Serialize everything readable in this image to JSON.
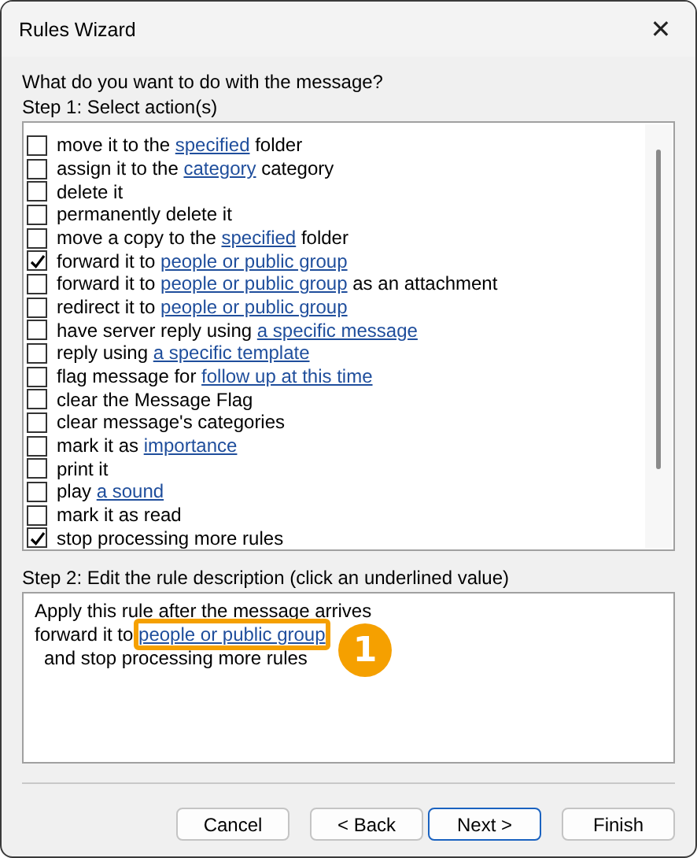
{
  "window": {
    "title": "Rules Wizard",
    "close": "✕"
  },
  "question": "What do you want to do with the message?",
  "step1": {
    "label": "Step 1: Select action(s)",
    "actions": [
      {
        "before": "move it to the ",
        "link": "specified",
        "after": " folder",
        "checked": false
      },
      {
        "before": "assign it to the ",
        "link": "category",
        "after": " category",
        "checked": false
      },
      {
        "before": "delete it",
        "checked": false
      },
      {
        "before": "permanently delete it",
        "checked": false
      },
      {
        "before": "move a copy to the ",
        "link": "specified",
        "after": " folder",
        "checked": false
      },
      {
        "before": "forward it to ",
        "link": "people or public group",
        "checked": true
      },
      {
        "before": "forward it to ",
        "link": "people or public group",
        "after": " as an attachment",
        "checked": false
      },
      {
        "before": "redirect it to ",
        "link": "people or public group",
        "checked": false
      },
      {
        "before": "have server reply using ",
        "link": "a specific message",
        "checked": false
      },
      {
        "before": "reply using ",
        "link": "a specific template",
        "checked": false
      },
      {
        "before": "flag message for ",
        "link": "follow up at this time",
        "checked": false
      },
      {
        "before": "clear the Message Flag",
        "checked": false
      },
      {
        "before": "clear message's categories",
        "checked": false
      },
      {
        "before": "mark it as ",
        "link": "importance",
        "checked": false
      },
      {
        "before": "print it",
        "checked": false
      },
      {
        "before": "play ",
        "link": "a sound",
        "checked": false
      },
      {
        "before": "mark it as read",
        "checked": false
      },
      {
        "before": "stop processing more rules",
        "checked": true
      }
    ]
  },
  "step2": {
    "label": "Step 2: Edit the rule description (click an underlined value)",
    "lines": [
      {
        "before": "Apply this rule after the message arrives",
        "indented": false,
        "highlighted": false
      },
      {
        "before": "forward it to ",
        "link": "people or public group",
        "indented": false,
        "highlighted": true,
        "callout": "1"
      },
      {
        "before": "and stop processing more rules",
        "indented": true,
        "highlighted": false
      }
    ]
  },
  "buttons": [
    {
      "label": "Cancel",
      "default": false
    },
    {
      "label": "< Back",
      "default": false
    },
    {
      "label": "Next >",
      "default": true
    },
    {
      "label": "Finish",
      "default": false
    }
  ]
}
